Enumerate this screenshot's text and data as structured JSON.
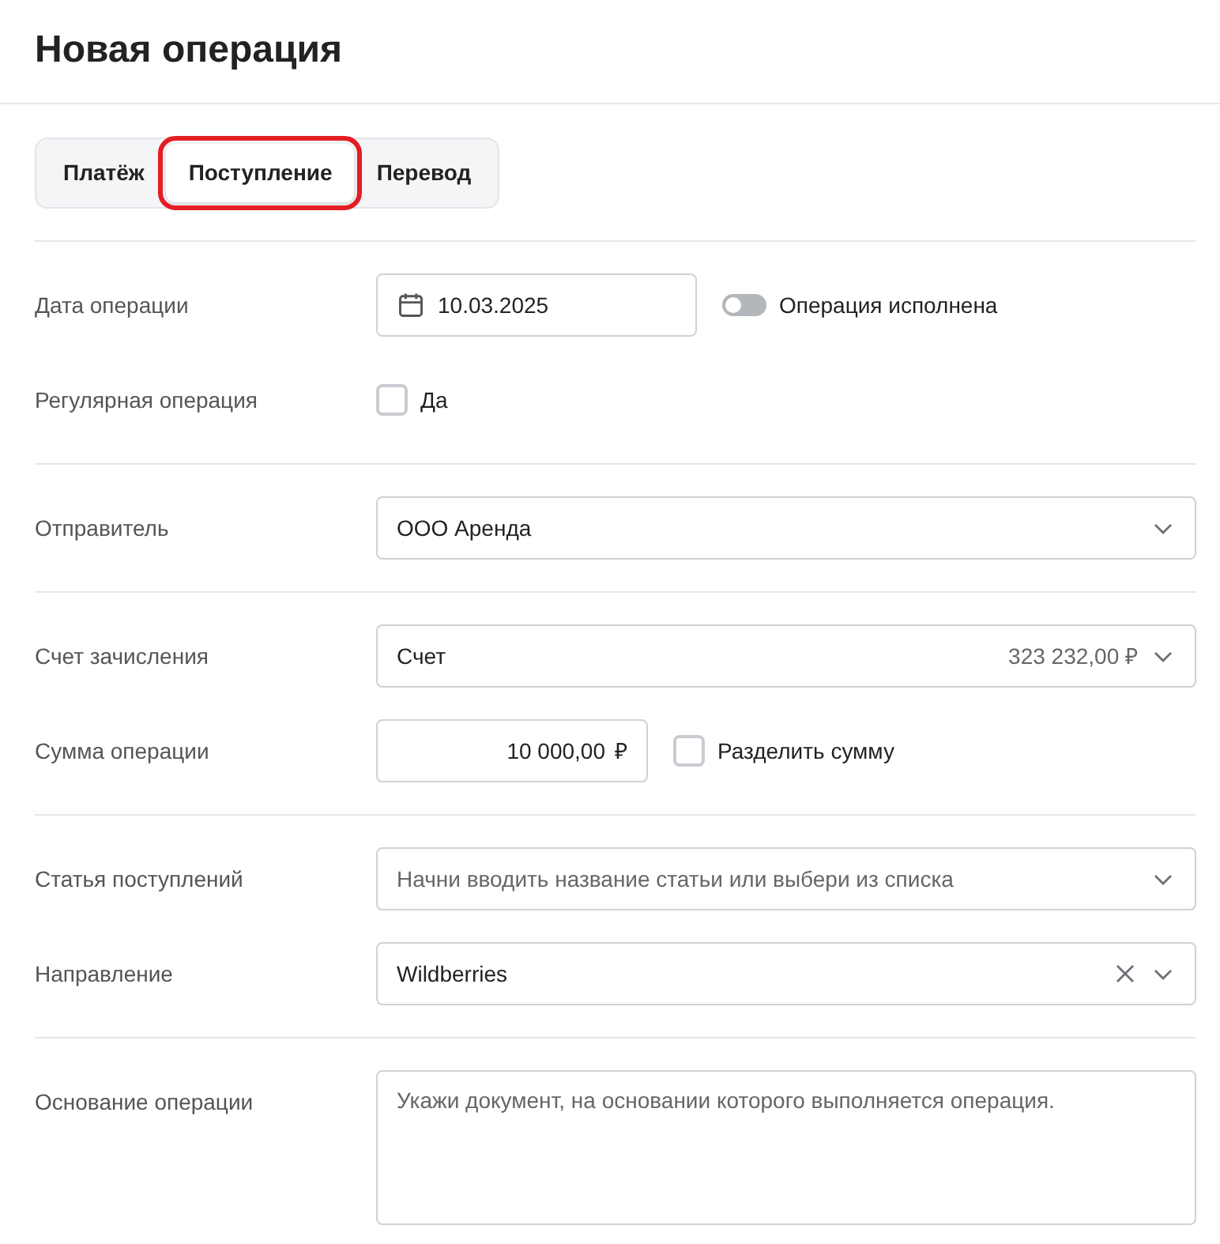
{
  "title": "Новая операция",
  "tabs": [
    {
      "label": "Платёж",
      "selected": false,
      "highlighted": false
    },
    {
      "label": "Поступление",
      "selected": true,
      "highlighted": true
    },
    {
      "label": "Перевод",
      "selected": false,
      "highlighted": false
    }
  ],
  "sections": [
    {
      "rows": [
        {
          "kind": "date",
          "label": "Дата операции",
          "value": "10.03.2025",
          "toggle": {
            "label": "Операция исполнена",
            "on": false
          }
        },
        {
          "kind": "checkbox",
          "label": "Регулярная операция",
          "option": {
            "label": "Да",
            "checked": false
          }
        }
      ]
    },
    {
      "rows": [
        {
          "kind": "select",
          "label": "Отправитель",
          "value": "ООО Аренда"
        }
      ]
    },
    {
      "rows": [
        {
          "kind": "select",
          "label": "Счет зачисления",
          "value": "Счет",
          "balance": "323 232,00 ₽"
        },
        {
          "kind": "amount",
          "label": "Сумма операции",
          "value": "10 000,00",
          "currency": "₽",
          "option": {
            "label": "Разделить сумму",
            "checked": false
          }
        }
      ]
    },
    {
      "rows": [
        {
          "kind": "select",
          "label": "Статья поступлений",
          "placeholder": "Начни вводить название статьи или выбери из списка"
        },
        {
          "kind": "select",
          "label": "Направление",
          "value": "Wildberries",
          "clearable": true
        }
      ]
    },
    {
      "rows": [
        {
          "kind": "textarea",
          "label": "Основание операции",
          "placeholder": "Укажи документ, на основании которого выполняется операция."
        }
      ]
    }
  ]
}
